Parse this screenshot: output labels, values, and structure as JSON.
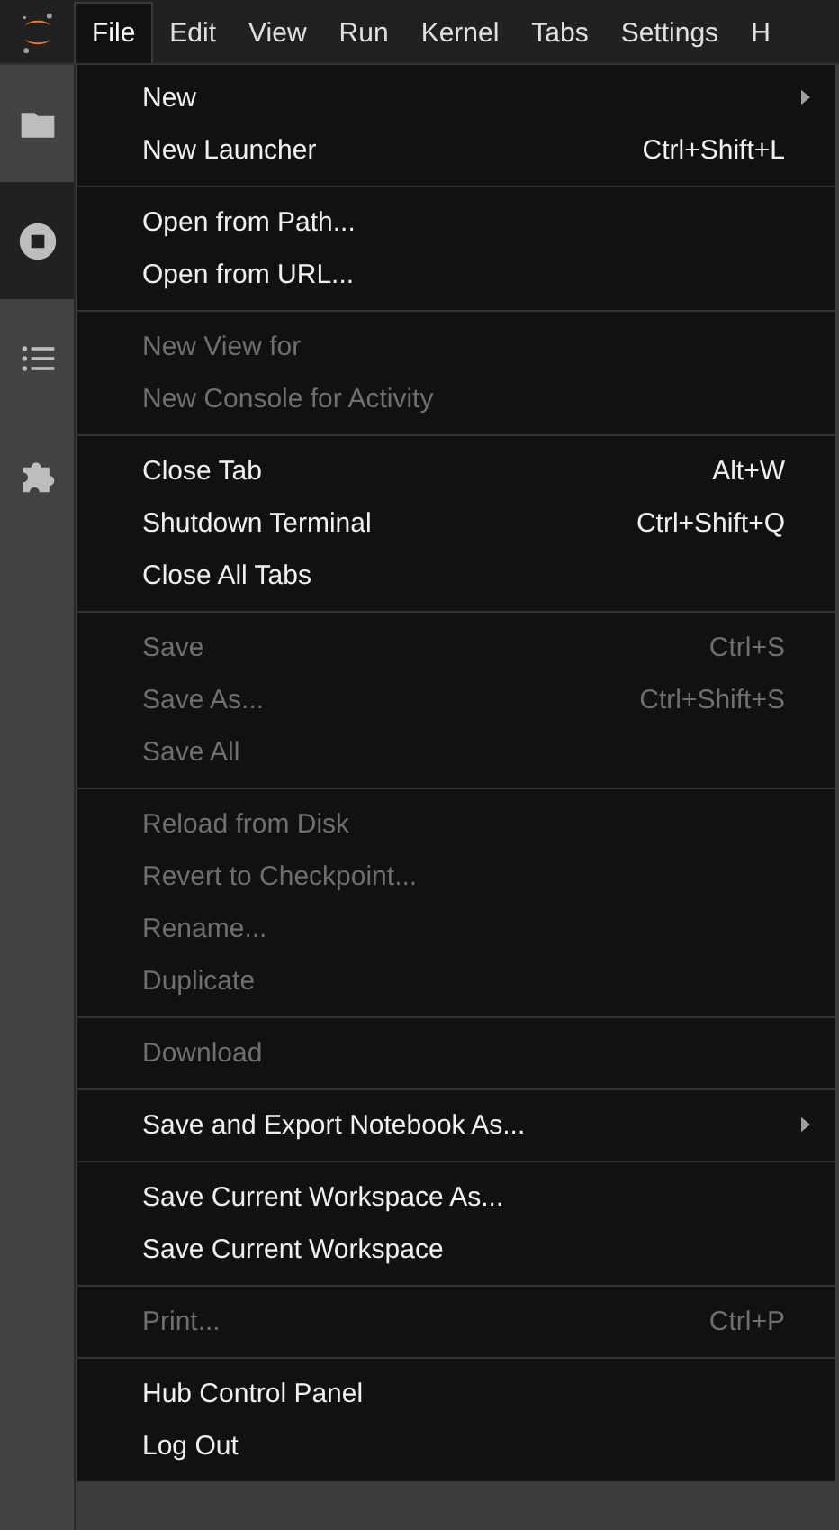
{
  "menubar": [
    {
      "label": "File",
      "selected": true
    },
    {
      "label": "Edit",
      "selected": false
    },
    {
      "label": "View",
      "selected": false
    },
    {
      "label": "Run",
      "selected": false
    },
    {
      "label": "Kernel",
      "selected": false
    },
    {
      "label": "Tabs",
      "selected": false
    },
    {
      "label": "Settings",
      "selected": false
    },
    {
      "label": "H",
      "selected": false
    }
  ],
  "sidebar": [
    {
      "kind": "folder",
      "selected": false
    },
    {
      "kind": "stop",
      "selected": true
    },
    {
      "kind": "list",
      "selected": false
    },
    {
      "kind": "puzzle",
      "selected": false
    }
  ],
  "menu": [
    [
      {
        "label": "New",
        "disabled": false,
        "submenu": true
      },
      {
        "label": "New Launcher",
        "shortcut": "Ctrl+Shift+L",
        "disabled": false,
        "submenu": false
      }
    ],
    [
      {
        "label": "Open from Path...",
        "disabled": false,
        "submenu": false
      },
      {
        "label": "Open from URL...",
        "disabled": false,
        "submenu": false
      }
    ],
    [
      {
        "label": "New View for",
        "disabled": true,
        "submenu": false
      },
      {
        "label": "New Console for Activity",
        "disabled": true,
        "submenu": false
      }
    ],
    [
      {
        "label": "Close Tab",
        "shortcut": "Alt+W",
        "disabled": false,
        "submenu": false
      },
      {
        "label": "Shutdown Terminal",
        "shortcut": "Ctrl+Shift+Q",
        "disabled": false,
        "submenu": false
      },
      {
        "label": "Close All Tabs",
        "disabled": false,
        "submenu": false
      }
    ],
    [
      {
        "label": "Save",
        "shortcut": "Ctrl+S",
        "disabled": true,
        "submenu": false
      },
      {
        "label": "Save As...",
        "shortcut": "Ctrl+Shift+S",
        "disabled": true,
        "submenu": false
      },
      {
        "label": "Save All",
        "disabled": true,
        "submenu": false
      }
    ],
    [
      {
        "label": "Reload from Disk",
        "disabled": true,
        "submenu": false
      },
      {
        "label": "Revert to Checkpoint...",
        "disabled": true,
        "submenu": false
      },
      {
        "label": "Rename...",
        "disabled": true,
        "submenu": false
      },
      {
        "label": "Duplicate",
        "disabled": true,
        "submenu": false
      }
    ],
    [
      {
        "label": "Download",
        "disabled": true,
        "submenu": false
      }
    ],
    [
      {
        "label": "Save and Export Notebook As...",
        "disabled": false,
        "submenu": true
      }
    ],
    [
      {
        "label": "Save Current Workspace As...",
        "disabled": false,
        "submenu": false
      },
      {
        "label": "Save Current Workspace",
        "disabled": false,
        "submenu": false
      }
    ],
    [
      {
        "label": "Print...",
        "shortcut": "Ctrl+P",
        "disabled": true,
        "submenu": false
      }
    ],
    [
      {
        "label": "Hub Control Panel",
        "disabled": false,
        "submenu": false
      },
      {
        "label": "Log Out",
        "disabled": false,
        "submenu": false
      }
    ]
  ]
}
